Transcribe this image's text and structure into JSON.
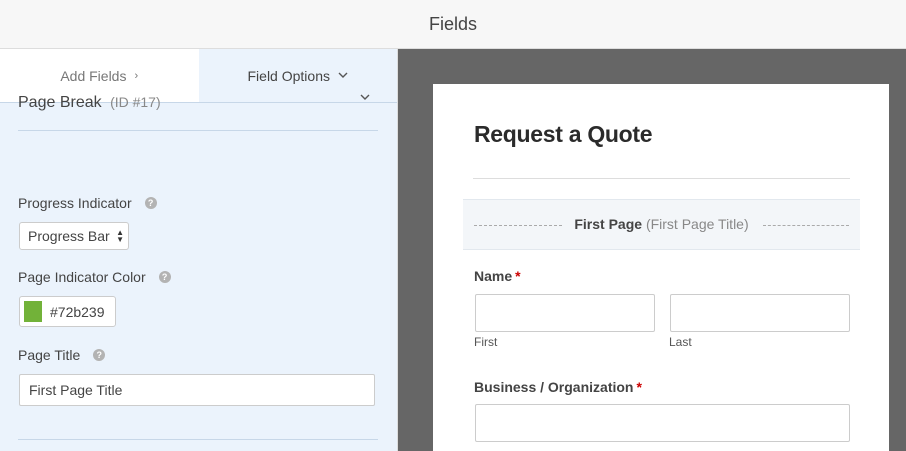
{
  "header": {
    "title": "Fields"
  },
  "tabs": [
    {
      "label": "Add Fields",
      "chevron": "›"
    },
    {
      "label": "Field Options",
      "chevron": "⌄"
    }
  ],
  "options": {
    "section_title": "Page Break",
    "section_id": "(ID #17)",
    "section_toggle": "⌄",
    "progress_indicator": {
      "label": "Progress Indicator",
      "help": "?",
      "selected": "Progress Bar"
    },
    "page_indicator_color": {
      "label": "Page Indicator Color",
      "help": "?",
      "value": "#72b239",
      "color": "#72b239"
    },
    "page_title": {
      "label": "Page Title",
      "help": "?",
      "value": "First Page Title"
    }
  },
  "preview": {
    "form_title": "Request a Quote",
    "page_break": {
      "name": "First Page",
      "subtitle": "(First Page Title)"
    },
    "fields": {
      "name": {
        "label": "Name",
        "required": "*",
        "sub_first": "First",
        "sub_last": "Last"
      },
      "business": {
        "label": "Business / Organization",
        "required": "*"
      }
    }
  }
}
